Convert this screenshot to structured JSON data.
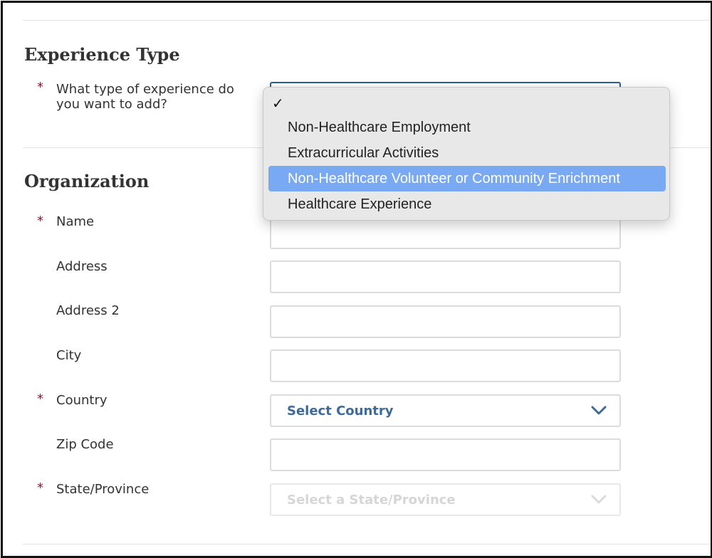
{
  "experience_section": {
    "title": "Experience Type",
    "question": "What type of experience do you want to add?",
    "dropdown": {
      "selected_check": "✓",
      "options": [
        "Non-Healthcare Employment",
        "Extracurricular Activities",
        "Non-Healthcare Volunteer or Community Enrichment",
        "Healthcare Experience"
      ],
      "highlighted_index": 2
    }
  },
  "organization_section": {
    "title": "Organization",
    "fields": {
      "name": {
        "label": "Name",
        "required": true
      },
      "address": {
        "label": "Address",
        "required": false
      },
      "address2": {
        "label": "Address 2",
        "required": false
      },
      "city": {
        "label": "City",
        "required": false
      },
      "country": {
        "label": "Country",
        "required": true,
        "value": "Select Country"
      },
      "zip": {
        "label": "Zip Code",
        "required": false
      },
      "state": {
        "label": "State/Province",
        "required": true,
        "value": "Select a State/Province",
        "disabled": true
      }
    }
  },
  "required_marker": "*",
  "colors": {
    "required": "#8b1a2e",
    "select_text": "#3d6a9a",
    "highlight": "#7aa9f3",
    "focus_border": "#2f5e8e"
  }
}
